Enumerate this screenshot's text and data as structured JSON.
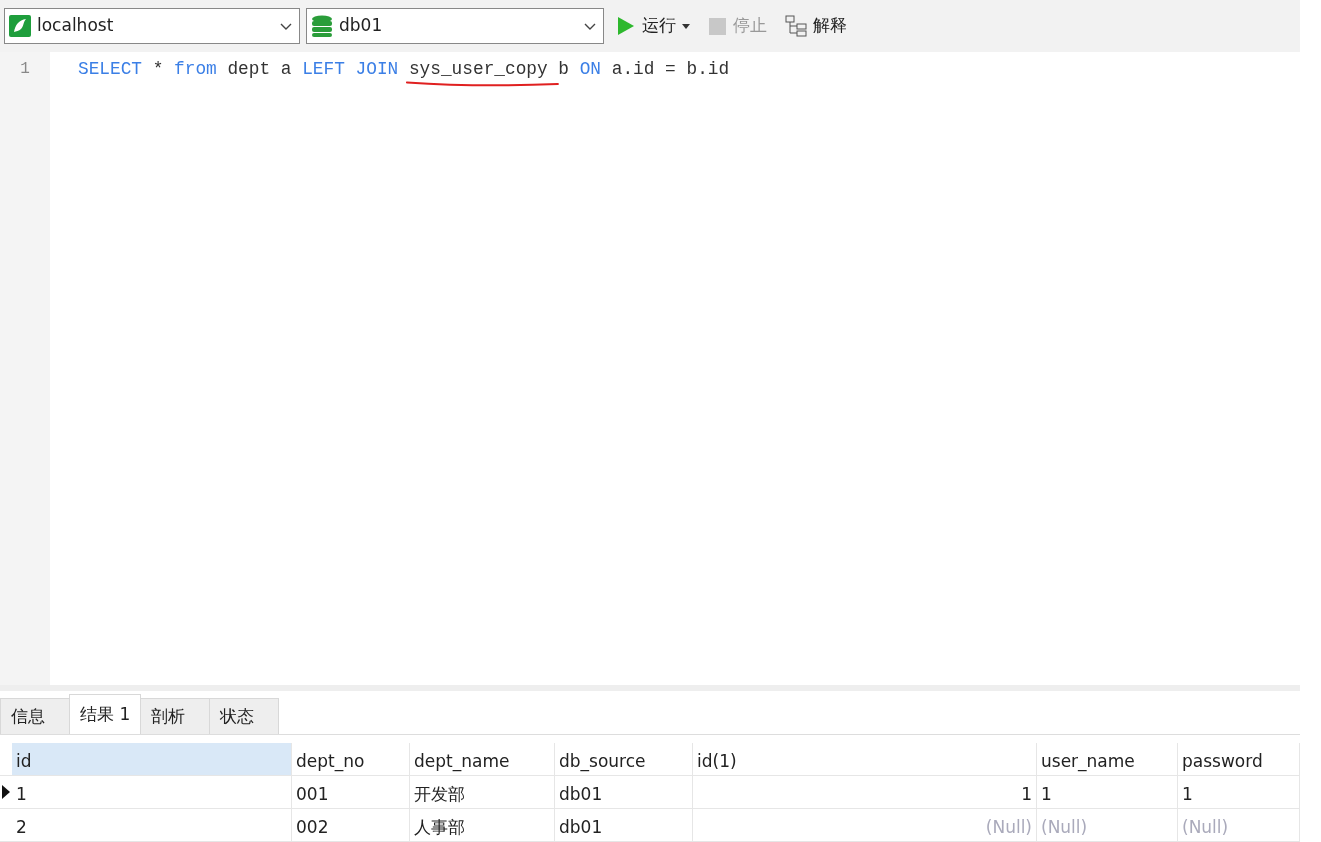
{
  "toolbar": {
    "connection": "localhost",
    "database": "db01",
    "buttons": [
      {
        "label": "运行",
        "kind": "run",
        "disabled": false,
        "dropdown": true
      },
      {
        "label": "停止",
        "kind": "stop",
        "disabled": true,
        "dropdown": false
      },
      {
        "label": "解释",
        "kind": "explain",
        "disabled": false,
        "dropdown": false
      }
    ]
  },
  "editor": {
    "lines": [
      {
        "number": "1",
        "tokens": [
          {
            "text": "SELECT",
            "kind": "keyword",
            "underlined": false
          },
          {
            "text": "*",
            "kind": "plain",
            "underlined": false
          },
          {
            "text": "from",
            "kind": "keyword",
            "underlined": false
          },
          {
            "text": "dept",
            "kind": "plain",
            "underlined": false
          },
          {
            "text": "a",
            "kind": "plain",
            "underlined": false
          },
          {
            "text": "LEFT",
            "kind": "keyword",
            "underlined": false
          },
          {
            "text": "JOIN",
            "kind": "keyword",
            "underlined": false
          },
          {
            "text": "sys_user_copy",
            "kind": "plain",
            "underlined": true
          },
          {
            "text": "b",
            "kind": "plain",
            "underlined": false
          },
          {
            "text": "ON",
            "kind": "keyword",
            "underlined": false
          },
          {
            "text": "a.id",
            "kind": "plain",
            "underlined": false
          },
          {
            "text": "=",
            "kind": "plain",
            "underlined": false
          },
          {
            "text": "b.id",
            "kind": "plain",
            "underlined": false
          }
        ]
      }
    ]
  },
  "result_tabs": [
    {
      "label": "信息",
      "selected": false
    },
    {
      "label": "结果 1",
      "selected": true
    },
    {
      "label": "剖析",
      "selected": false
    },
    {
      "label": "状态",
      "selected": false
    }
  ],
  "table": {
    "columns": [
      {
        "name": "id",
        "kind": "text",
        "selected": true
      },
      {
        "name": "dept_no",
        "kind": "text",
        "selected": false
      },
      {
        "name": "dept_name",
        "kind": "text",
        "selected": false
      },
      {
        "name": "db_source",
        "kind": "text",
        "selected": false
      },
      {
        "name": "id(1)",
        "kind": "number",
        "selected": false
      },
      {
        "name": "user_name",
        "kind": "text",
        "selected": false
      },
      {
        "name": "password",
        "kind": "text",
        "selected": false
      }
    ],
    "rows": [
      {
        "current": true,
        "cells": [
          {
            "text": "1",
            "null": false
          },
          {
            "text": "001",
            "null": false
          },
          {
            "text": "开发部",
            "null": false
          },
          {
            "text": "db01",
            "null": false
          },
          {
            "text": "1",
            "null": false
          },
          {
            "text": "1",
            "null": false
          },
          {
            "text": "1",
            "null": false
          }
        ]
      },
      {
        "current": false,
        "cells": [
          {
            "text": "2",
            "null": false
          },
          {
            "text": "002",
            "null": false
          },
          {
            "text": "人事部",
            "null": false
          },
          {
            "text": "db01",
            "null": false
          },
          {
            "text": "(Null)",
            "null": true
          },
          {
            "text": "(Null)",
            "null": true
          },
          {
            "text": "(Null)",
            "null": true
          }
        ]
      }
    ]
  }
}
